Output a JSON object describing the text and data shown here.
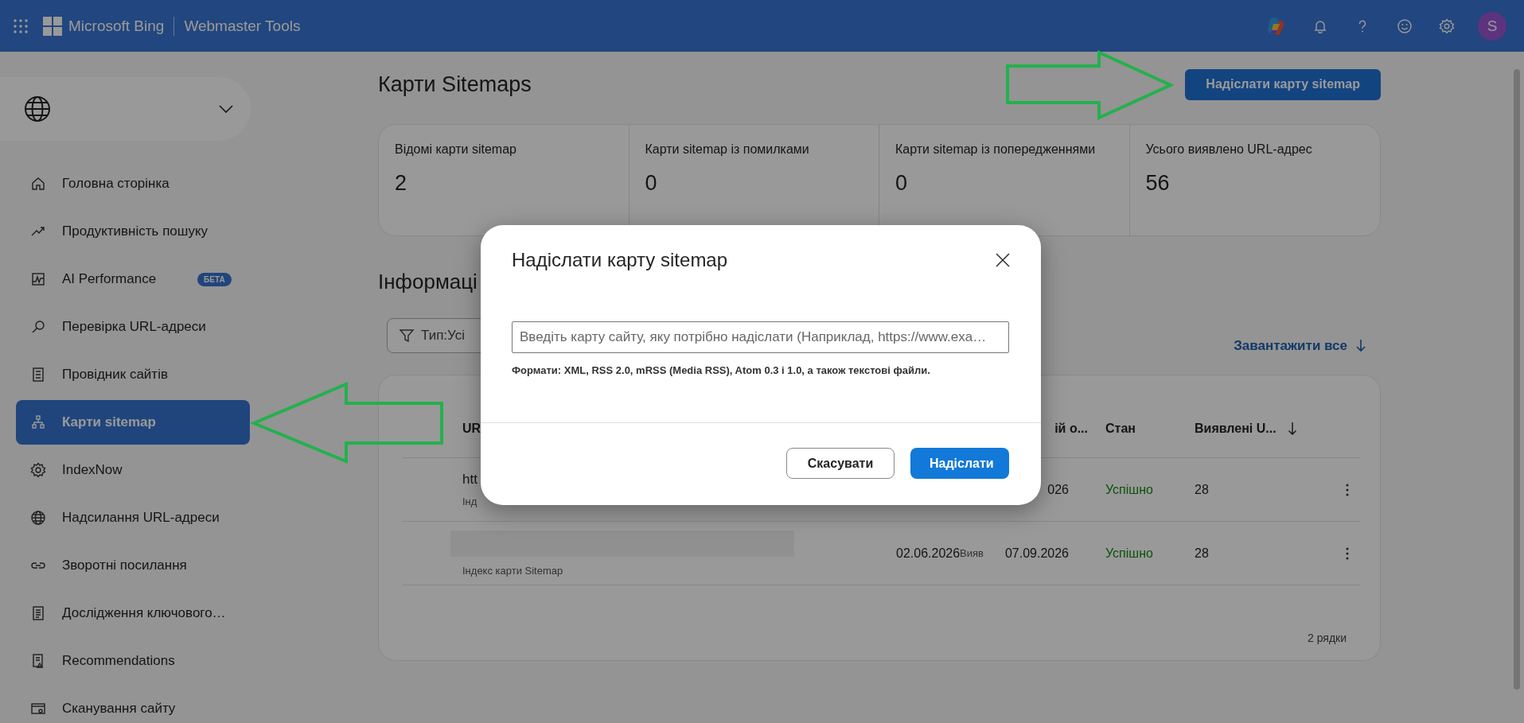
{
  "header": {
    "brand": "Microsoft Bing",
    "product": "Webmaster Tools",
    "avatar": "S"
  },
  "sidebar": {
    "items": [
      {
        "label": "Головна сторінка",
        "selected": false
      },
      {
        "label": "Продуктивність пошуку",
        "selected": false
      },
      {
        "label": "AI Performance",
        "selected": false,
        "badge": "БЕТА"
      },
      {
        "label": "Перевірка URL-адреси",
        "selected": false
      },
      {
        "label": "Провідник сайтів",
        "selected": false
      },
      {
        "label": "Карти sitemap",
        "selected": true
      },
      {
        "label": "IndexNow",
        "selected": false
      },
      {
        "label": "Надсилання URL-адреси",
        "selected": false
      },
      {
        "label": "Зворотні посилання",
        "selected": false
      },
      {
        "label": "Дослідження ключового…",
        "selected": false
      },
      {
        "label": "Recommendations",
        "selected": false
      },
      {
        "label": "Сканування сайту",
        "selected": false
      }
    ]
  },
  "page": {
    "title": "Карти Sitemaps",
    "submit_button": "Надіслати карту sitemap"
  },
  "stats": [
    {
      "label": "Відомі карти sitemap",
      "value": "2"
    },
    {
      "label": "Карти sitemap із помилками",
      "value": "0"
    },
    {
      "label": "Карти sitemap із попередженнями",
      "value": "0"
    },
    {
      "label": "Усього виявлено URL-адрес",
      "value": "56"
    }
  ],
  "section_title": "Інформаці",
  "filter": {
    "label": "Тип:Усі"
  },
  "download_link": "Завантажити все",
  "table": {
    "columns": {
      "url": "UR",
      "last_read": "ій о...",
      "status": "Стан",
      "discovered": "Виявлені U..."
    },
    "rows": [
      {
        "redacted": false,
        "url": "htt",
        "type": "Інд",
        "last_read": "026",
        "status": "Успішно",
        "discovered": "28"
      },
      {
        "redacted": true,
        "type": "Індекс карти Sitemap",
        "submitted": "02.06.2026",
        "submitted_note": "Вияв",
        "last_read": "07.09.2026",
        "status": "Успішно",
        "discovered": "28"
      }
    ],
    "footer": "2 рядки"
  },
  "dialog": {
    "title": "Надіслати карту sitemap",
    "input": {
      "placeholder": "Введіть карту сайту, яку потрібно надіслати (Наприклад, https://www.exa…"
    },
    "hint": "Формати: XML, RSS 2.0, mRSS (Media RSS), Atom 0.3 і 1.0, а також текстові файли.",
    "cancel_button": "Скасувати",
    "submit_button": "Надіслати"
  }
}
